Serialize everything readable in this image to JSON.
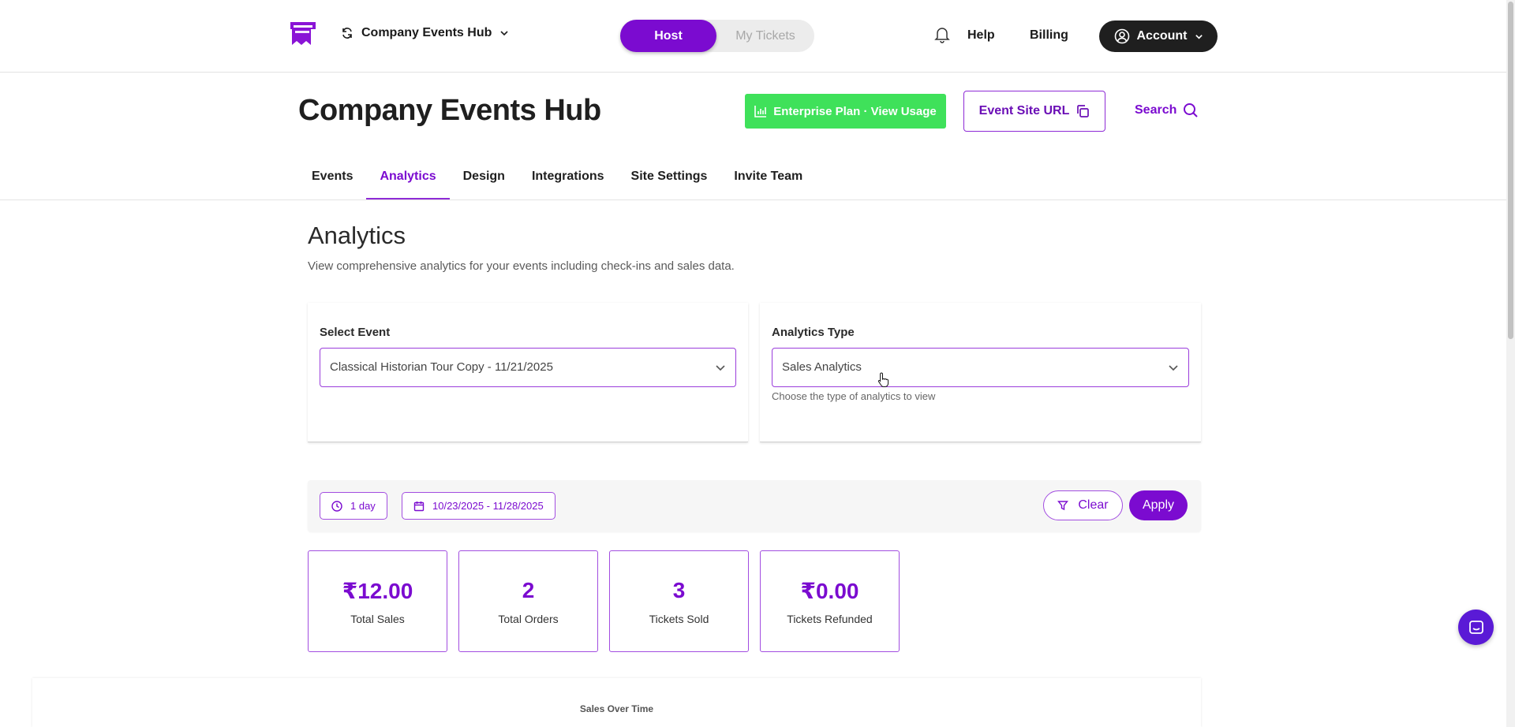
{
  "topbar": {
    "hub_name": "Company Events Hub",
    "mode_host": "Host",
    "mode_tickets": "My Tickets",
    "help": "Help",
    "billing": "Billing",
    "account": "Account"
  },
  "header": {
    "title": "Company Events Hub",
    "plan_button": "Enterprise Plan · View Usage",
    "site_url_button": "Event Site URL",
    "search": "Search"
  },
  "tabs": [
    {
      "label": "Events"
    },
    {
      "label": "Analytics"
    },
    {
      "label": "Design"
    },
    {
      "label": "Integrations"
    },
    {
      "label": "Site Settings"
    },
    {
      "label": "Invite Team"
    }
  ],
  "active_tab": "Analytics",
  "analytics": {
    "title": "Analytics",
    "subtitle": "View comprehensive analytics for your events including check-ins and sales data."
  },
  "select_event": {
    "label": "Select Event",
    "value": "Classical Historian Tour Copy - 11/21/2025"
  },
  "analytics_type": {
    "label": "Analytics Type",
    "value": "Sales Analytics",
    "hint": "Choose the type of analytics to view"
  },
  "filters": {
    "interval": "1 day",
    "date_range": "10/23/2025 - 11/28/2025",
    "clear": "Clear",
    "apply": "Apply"
  },
  "stats": [
    {
      "value": "₹12.00",
      "caption": "Total Sales"
    },
    {
      "value": "2",
      "caption": "Total Orders"
    },
    {
      "value": "3",
      "caption": "Tickets Sold"
    },
    {
      "value": "₹0.00",
      "caption": "Tickets Refunded"
    }
  ],
  "chart": {
    "title": "Sales Over Time"
  },
  "colors": {
    "brand_purple": "#7b0bd0",
    "plan_green": "#3fe15a",
    "account_dark": "#1f1f1f",
    "chat_blue": "#5a1ad6"
  }
}
